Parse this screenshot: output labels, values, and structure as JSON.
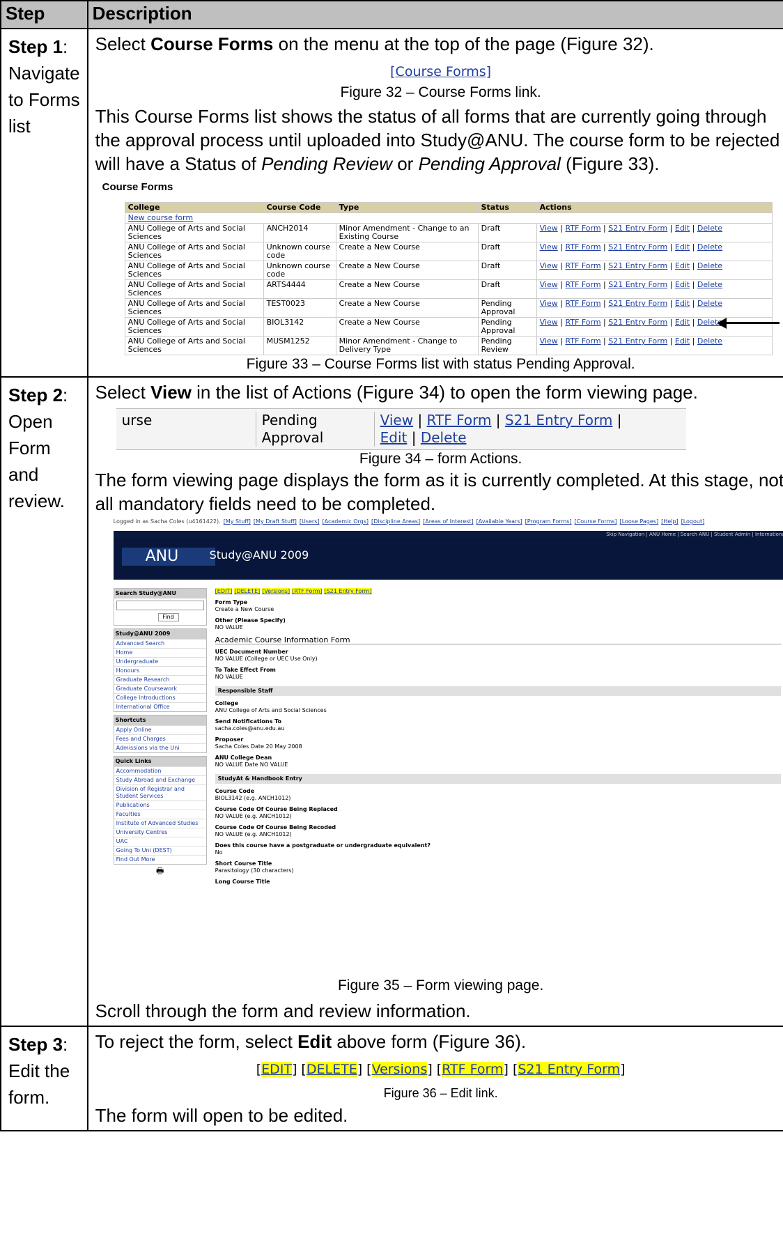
{
  "header": {
    "step": "Step",
    "description": "Description"
  },
  "step1": {
    "label": "Step 1",
    "title_tail": ":",
    "title": "Navigate to Forms list",
    "p1_a": "Select ",
    "p1_b": "Course Forms",
    "p1_c": " on the menu at the top of the page (Figure 32).",
    "fig32_link": "[Course Forms]",
    "fig32_caption": "Figure 32 – Course Forms link.",
    "p2_a": "This Course Forms list shows the status of all forms that are currently going through the approval process until uploaded into Study@ANU.  The course form to be rejected will have a Status of ",
    "p2_b": "Pending Review",
    "p2_c": " or ",
    "p2_d": "Pending Approval",
    "p2_e": " (Figure 33).",
    "cf_title": "Course Forms",
    "cf_cols": [
      "College",
      "Course Code",
      "Type",
      "Status",
      "Actions"
    ],
    "cf_new": "New course form",
    "cf_rows": [
      [
        "ANU College of Arts and Social Sciences",
        "ANCH2014",
        "Minor Amendment - Change to an Existing Course",
        "Draft"
      ],
      [
        "ANU College of Arts and Social Sciences",
        "Unknown course code",
        "Create a New Course",
        "Draft"
      ],
      [
        "ANU College of Arts and Social Sciences",
        "Unknown course code",
        "Create a New Course",
        "Draft"
      ],
      [
        "ANU College of Arts and Social Sciences",
        "ARTS4444",
        "Create a New Course",
        "Draft"
      ],
      [
        "ANU College of Arts and Social Sciences",
        "TEST0023",
        "Create a New Course",
        "Pending Approval"
      ],
      [
        "ANU College of Arts and Social Sciences",
        "BIOL3142",
        "Create a New Course",
        "Pending Approval"
      ],
      [
        "ANU College of Arts and Social Sciences",
        "MUSM1252",
        "Minor Amendment - Change to Delivery Type",
        "Pending Review"
      ]
    ],
    "cf_actions": [
      "View",
      "RTF Form",
      "S21 Entry Form",
      "Edit",
      "Delete"
    ],
    "fig33_caption": "Figure 33 – Course Forms list with status Pending Approval."
  },
  "step2": {
    "label": "Step 2",
    "title_tail": ":",
    "title": "Open Form and review.",
    "p1_a": "Select ",
    "p1_b": "View",
    "p1_c": " in the list of Actions (Figure 34) to open the form viewing page.",
    "fig34_a": "urse",
    "fig34_b1": "Pending",
    "fig34_b2": "Approval",
    "fig34_caption": "Figure 34 – form Actions.",
    "p2": "The form viewing page displays the form as it is currently completed.  At this stage, not all mandatory fields need to be completed.",
    "ss": {
      "login": "Logged in as Sacha Coles (u4161422).",
      "toplinks": [
        "[My Stuff]",
        "[My Draft Stuff]",
        "[Users]",
        "[Academic Orgs]",
        "[Discipline Areas]",
        "[Areas of Interest]",
        "[Available Years]",
        "[Program Forms]",
        "[Course Forms]",
        "[Loose Pages]",
        "[Help]",
        "[Logout]"
      ],
      "bar": "Skip Navigation | ANU Home | Search ANU | Student Admin | International",
      "logo": "ANU",
      "site": "Study@ANU 2009",
      "search_head": "Search Study@ANU",
      "find": "Find",
      "nav_head": "Study@ANU 2009",
      "nav": [
        "Advanced Search",
        "Home",
        "Undergraduate",
        "Honours",
        "Graduate Research",
        "Graduate Coursework",
        "College Introductions",
        "International Office"
      ],
      "short_head": "Shortcuts",
      "short": [
        "Apply Online",
        "Fees and Charges",
        "Admissions via the Uni"
      ],
      "quick_head": "Quick Links",
      "quick": [
        "Accommodation",
        "Study Abroad and Exchange",
        "Division of Registrar and Student Services",
        "Publications",
        "Faculties",
        "Institute of Advanced Studies",
        "University Centres",
        "UAC",
        "Going To Uni (DEST)",
        "Find Out More"
      ],
      "links": [
        "[EDIT]",
        "[DELETE]",
        "[Versions]",
        "[RTF Form]",
        "[S21 Entry Form]"
      ],
      "f1l": "Form Type",
      "f1v": "Create a New Course",
      "f2l": "Other (Please Specify)",
      "f2v": "NO VALUE",
      "h1": "Academic Course Information Form",
      "f3l": "UEC Document Number",
      "f3v": "NO VALUE (College or UEC Use Only)",
      "f4l": "To Take Effect From",
      "f4v": "NO VALUE",
      "s1": "Responsible Staff",
      "f5l": "College",
      "f5v": "ANU College of Arts and Social Sciences",
      "f6l": "Send Notifications To",
      "f6v": "sacha.coles@anu.edu.au",
      "f7l": "Proposer",
      "f7v": "Sacha Coles Date 20 May 2008",
      "f8l": "ANU College Dean",
      "f8v": "NO VALUE Date NO VALUE",
      "s2": "StudyAt & Handbook Entry",
      "f9l": "Course Code",
      "f9v": "BIOL3142 (e.g. ANCH1012)",
      "f10l": "Course Code Of Course Being Replaced",
      "f10v": "NO VALUE (e.g. ANCH1012)",
      "f11l": "Course Code Of Course Being Recoded",
      "f11v": "NO VALUE (e.g. ANCH1012)",
      "f12l": "Does this course have a postgraduate or undergraduate equivalent?",
      "f12v": "No",
      "f13l": "Short Course Title",
      "f13v": "Parasitology (30 characters)",
      "f14l": "Long Course Title"
    },
    "fig35_caption": "Figure 35 – Form viewing page.",
    "p3": "Scroll through the form and review information."
  },
  "step3": {
    "label": "Step 3",
    "title_tail": ":",
    "title": "Edit the form.",
    "p1_a": "To reject the form, select ",
    "p1_b": "Edit",
    "p1_c": " above form (Figure 36).",
    "fig36_links": [
      "EDIT",
      "DELETE",
      "Versions",
      "RTF Form",
      "S21 Entry Form"
    ],
    "fig36_caption": "Figure 36 – Edit link.",
    "p2": "The form will open to be edited."
  }
}
